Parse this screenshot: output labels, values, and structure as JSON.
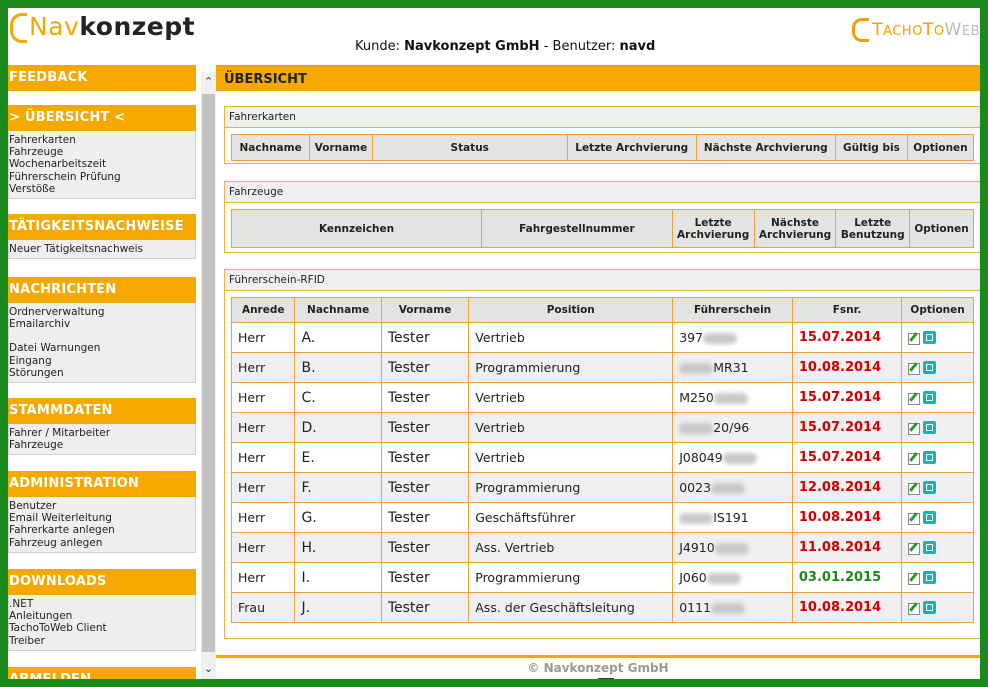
{
  "header": {
    "logo_nav": "Nav",
    "logo_konzept": "konzept",
    "tacho_first": "T",
    "tacho_rest": "ACHO",
    "tacho_second": "T",
    "tacho_rest2": "O",
    "tacho_third": "W",
    "tacho_rest3": "EB",
    "kunde_label": "Kunde: ",
    "kunde_value": "Navkonzept GmbH",
    "benutzer_label": " - Benutzer: ",
    "benutzer_value": "navd"
  },
  "sidebar": {
    "feedback": "FEEDBACK",
    "uebersicht": "> ÜBERSICHT <",
    "uebersicht_items": [
      "Fahrerkarten",
      "Fahrzeuge",
      "Wochenarbeitszeit",
      "Führerschein Prüfung",
      "Verstöße"
    ],
    "taetigkeit": "TÄTIGKEITSNACHWEISE",
    "taetigkeit_items": [
      "Neuer Tätigkeitsnachweis"
    ],
    "nachrichten": "NACHRICHTEN",
    "nachrichten_items_a": [
      "Ordnerverwaltung",
      "Emailarchiv"
    ],
    "nachrichten_items_b": [
      "Datei Warnungen",
      "Eingang",
      "Störungen"
    ],
    "stammdaten": "STAMMDATEN",
    "stammdaten_items": [
      "Fahrer / Mitarbeiter",
      "Fahrzeuge"
    ],
    "administration": "ADMINISTRATION",
    "administration_items": [
      "Benutzer",
      "Email Weiterleitung",
      "Fahrerkarte anlegen",
      "Fahrzeug anlegen"
    ],
    "downloads": "DOWNLOADS",
    "downloads_items": [
      ".NET",
      "Anleitungen",
      "TachoToWeb Client",
      "Treiber"
    ],
    "abmelden": "ABMELDEN"
  },
  "main": {
    "title": "ÜBERSICHT",
    "fahrerkarten": {
      "title": "Fahrerkarten",
      "columns": [
        "Nachname",
        "Vorname",
        "Status",
        "Letzte Archvierung",
        "Nächste Archvierung",
        "Gültig bis",
        "Optionen"
      ]
    },
    "fahrzeuge": {
      "title": "Fahrzeuge",
      "columns": [
        "Kennzeichen",
        "Fahrgestellnummer",
        "Letzte Archvierung",
        "Nächste Archvierung",
        "Letzte Benutzung",
        "Optionen"
      ]
    },
    "rfid": {
      "title": "Führerschein-RFID",
      "columns": [
        "Anrede",
        "Nachname",
        "Vorname",
        "Position",
        "Führerschein",
        "Fsnr.",
        "Optionen"
      ],
      "rows": [
        {
          "anrede": "Herr",
          "nachname": "A.",
          "vorname": "Tester",
          "position": "Vertrieb",
          "fs_pre": "397",
          "fs_post": "",
          "date": "15.07.2014",
          "status": "red"
        },
        {
          "anrede": "Herr",
          "nachname": "B.",
          "vorname": "Tester",
          "position": "Programmierung",
          "fs_pre": "",
          "fs_post": "MR31",
          "date": "10.08.2014",
          "status": "red"
        },
        {
          "anrede": "Herr",
          "nachname": "C.",
          "vorname": "Tester",
          "position": "Vertrieb",
          "fs_pre": "M250",
          "fs_post": "",
          "date": "15.07.2014",
          "status": "red"
        },
        {
          "anrede": "Herr",
          "nachname": "D.",
          "vorname": "Tester",
          "position": "Vertrieb",
          "fs_pre": "",
          "fs_post": "20/96",
          "date": "15.07.2014",
          "status": "red"
        },
        {
          "anrede": "Herr",
          "nachname": "E.",
          "vorname": "Tester",
          "position": "Vertrieb",
          "fs_pre": "J08049",
          "fs_post": "",
          "date": "15.07.2014",
          "status": "red"
        },
        {
          "anrede": "Herr",
          "nachname": "F.",
          "vorname": "Tester",
          "position": "Programmierung",
          "fs_pre": "0023",
          "fs_post": "",
          "date": "12.08.2014",
          "status": "red"
        },
        {
          "anrede": "Herr",
          "nachname": "G.",
          "vorname": "Tester",
          "position": "Geschäftsführer",
          "fs_pre": "",
          "fs_post": "IS191",
          "date": "10.08.2014",
          "status": "red"
        },
        {
          "anrede": "Herr",
          "nachname": "H.",
          "vorname": "Tester",
          "position": "Ass. Vertrieb",
          "fs_pre": "J4910",
          "fs_post": "",
          "date": "11.08.2014",
          "status": "red"
        },
        {
          "anrede": "Herr",
          "nachname": "I.",
          "vorname": "Tester",
          "position": "Programmierung",
          "fs_pre": "J060",
          "fs_post": "",
          "date": "03.01.2015",
          "status": "green"
        },
        {
          "anrede": "Frau",
          "nachname": "J.",
          "vorname": "Tester",
          "position": "Ass. der Geschäftsleitung",
          "fs_pre": "0111",
          "fs_post": "",
          "date": "10.08.2014",
          "status": "red"
        }
      ]
    }
  },
  "footer": {
    "copyright": "© Navkonzept GmbH"
  },
  "colors": {
    "accent": "#f5a800",
    "frame": "#1a8a1a",
    "expired": "#d00000",
    "valid": "#1a8a1a"
  }
}
